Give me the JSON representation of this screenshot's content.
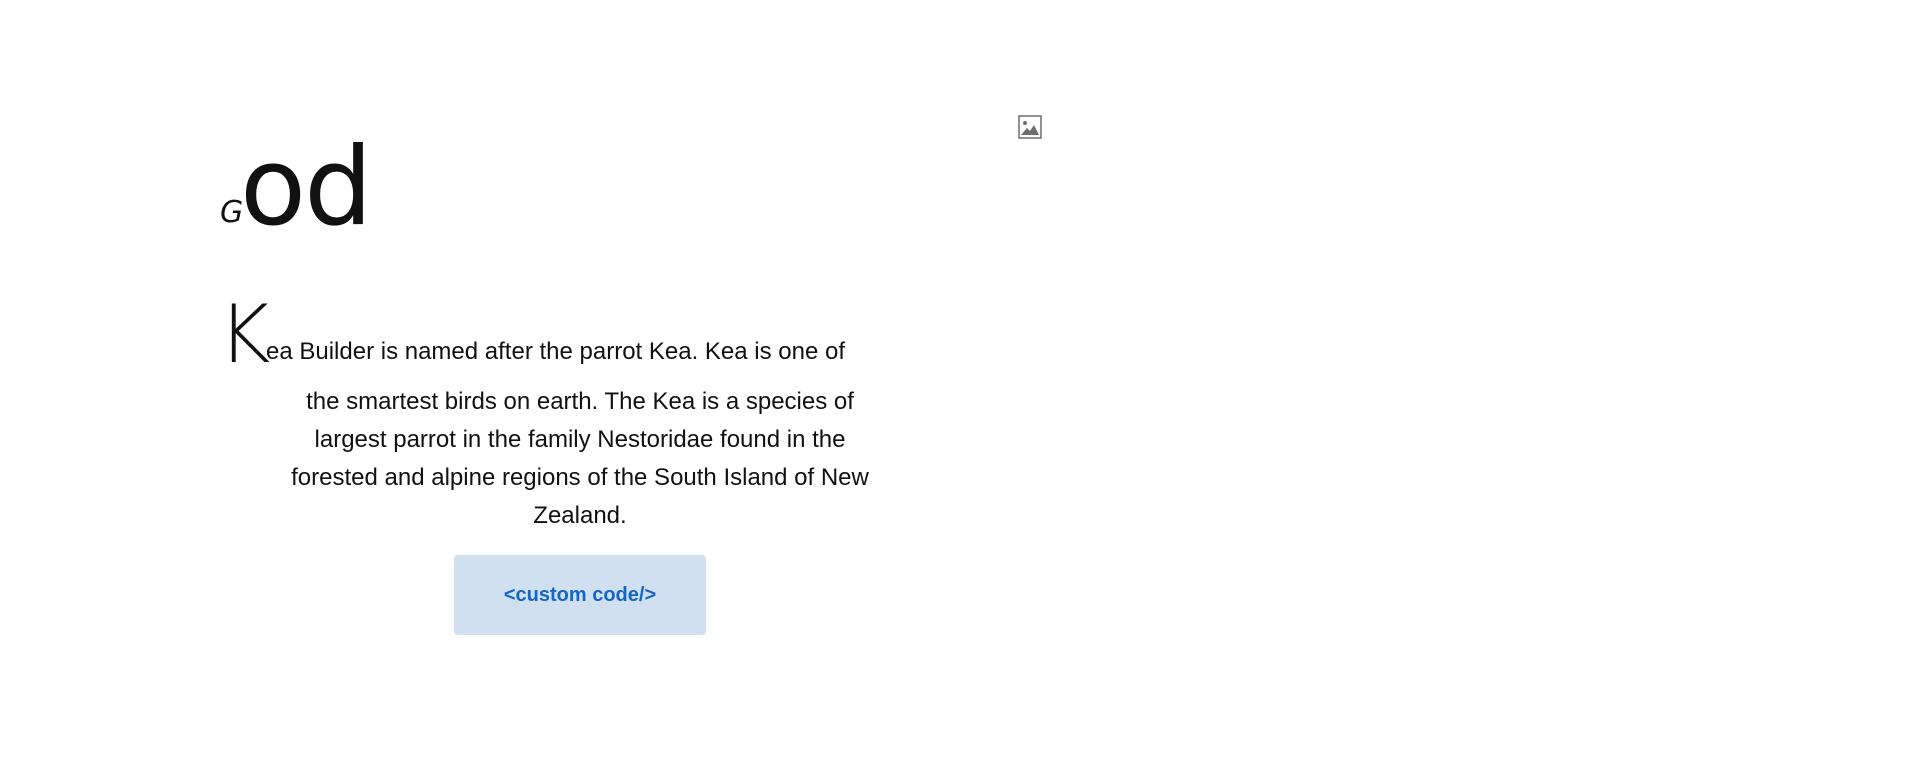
{
  "hero": {
    "small_letter": "G",
    "big_text": "od"
  },
  "intro": {
    "dropcap": "K",
    "first_line_rest": "ea Builder is named after the parrot Kea. Kea is one of",
    "lines": [
      "the smartest birds on earth. The Kea is a species of",
      "largest parrot in the family Nestoridae found in the",
      "forested and alpine regions of the South Island of New",
      "Zealand."
    ]
  },
  "cta": {
    "label": "<custom code/>"
  },
  "image": {
    "icon": "image-placeholder-icon"
  },
  "colors": {
    "button_bg": "#d1e0f1",
    "button_text": "#1366c4"
  }
}
